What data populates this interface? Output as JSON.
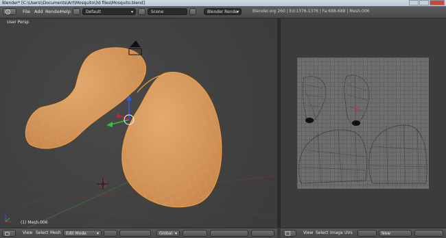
{
  "window": {
    "title": "Blender* [C:\\Users\\\\Documents\\Art\\Mosquito\\3d files\\Mosquito.blend]"
  },
  "info_header": {
    "menus": [
      "File",
      "Add",
      "Render",
      "Help"
    ],
    "screen_layout": "Default",
    "scene": "Scene",
    "render_engine": "Blender Render",
    "stats": "Blender.org 260 | Ed:1376-1376 | Fa:688-688 | Mesh.006"
  },
  "viewport3d": {
    "view_label": "User Persp",
    "object_name": "(1) Mesh.006",
    "header": {
      "menus": [
        "View",
        "Select",
        "Mesh"
      ],
      "mode": "Edit Mode",
      "orientation": "Global"
    }
  },
  "uv_editor": {
    "header": {
      "menus": [
        "View",
        "Select",
        "Image",
        "UVs"
      ],
      "new_button": "New"
    }
  },
  "colors": {
    "mesh": "#d69a5e",
    "wire": "#ffa23a",
    "uv_grid": "#6e6e6e",
    "background": "#3a3a3a"
  }
}
